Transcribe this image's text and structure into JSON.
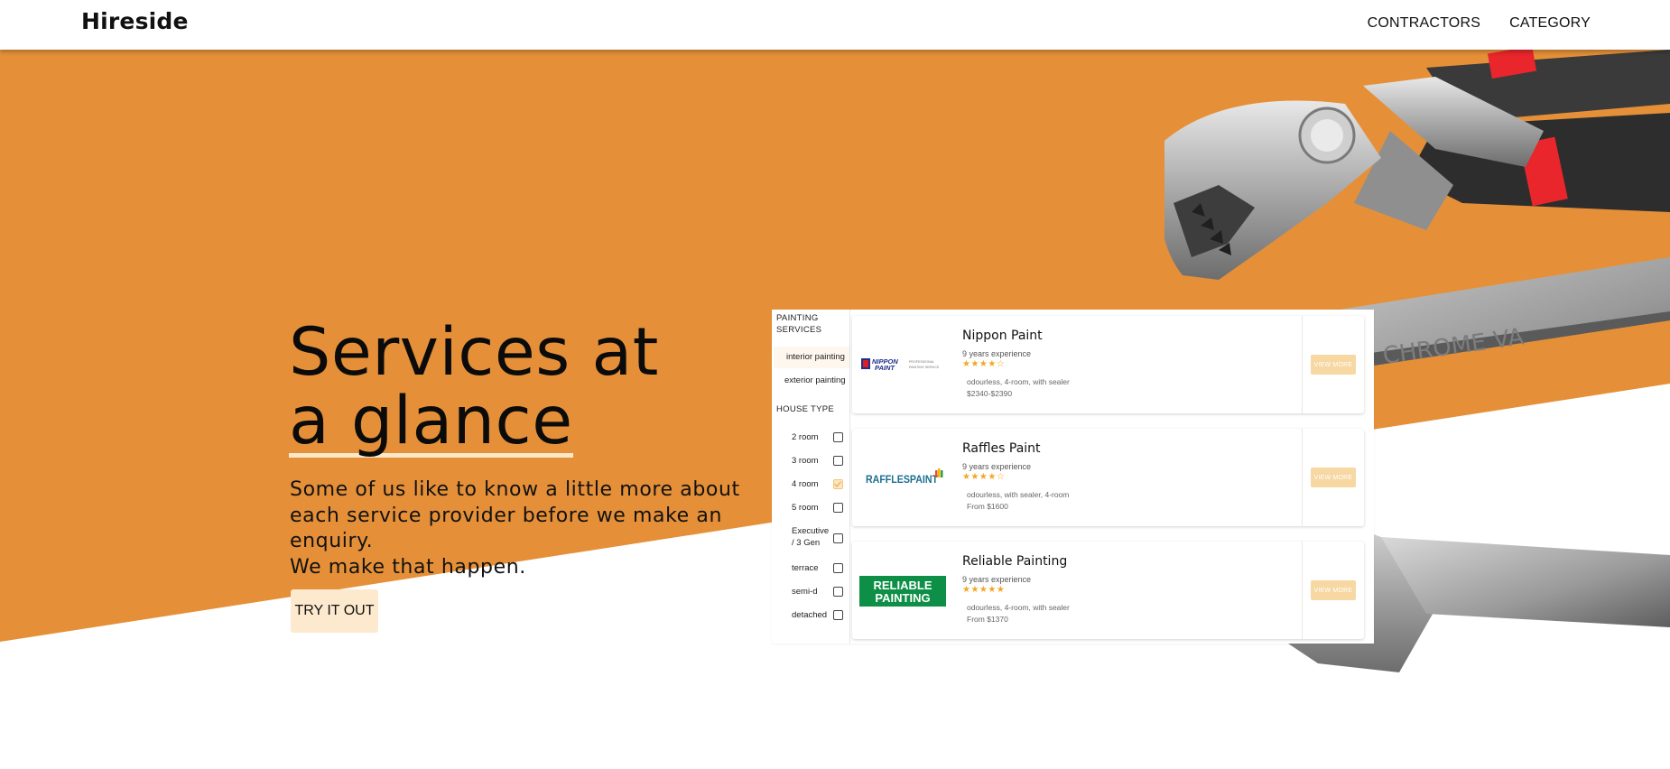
{
  "header": {
    "logo": "Hireside",
    "nav": [
      "CONTRACTORS",
      "CATEGORY"
    ]
  },
  "hero": {
    "title_line1": "Services at",
    "title_line2": "a glance",
    "description_lines": [
      "Some of us like to know a little more about each service provider before we make an enquiry.",
      "We make that happen."
    ],
    "cta_label": "TRY IT OUT"
  },
  "mockup": {
    "services_heading": "PAINTING SERVICES",
    "services": [
      "interior painting",
      "exterior painting"
    ],
    "active_service": "interior painting",
    "house_type_heading": "HOUSE TYPE",
    "house_types": [
      {
        "label": "2 room",
        "checked": false
      },
      {
        "label": "3 room",
        "checked": false
      },
      {
        "label": "4 room",
        "checked": true
      },
      {
        "label": "5 room",
        "checked": false
      },
      {
        "label": "Executive / 3 Gen",
        "checked": false
      },
      {
        "label": "terrace",
        "checked": false
      },
      {
        "label": "semi-d",
        "checked": false
      },
      {
        "label": "detached",
        "checked": false
      }
    ],
    "cards": [
      {
        "name": "Nippon Paint",
        "experience": "9 years experience",
        "stars": "★★★★☆",
        "tags": "odourless, 4-room, with sealer",
        "price": "$2340-$2390",
        "button": "VIEW MORE",
        "logo": {
          "brand": "NIPPON",
          "brand2": "PAINT",
          "sub1": "PROFESSIONAL",
          "sub2": "PAINTING SERVICE"
        }
      },
      {
        "name": "Raffles Paint",
        "experience": "9 years experience",
        "stars": "★★★★☆",
        "tags": "odourless, with sealer, 4-room",
        "price": "From $1600",
        "button": "VIEW MORE",
        "logo": {
          "brand": "RAFFLESPAINT"
        }
      },
      {
        "name": "Reliable Painting",
        "experience": "9 years experience",
        "stars": "★★★★★",
        "tags": "odourless, 4-room, with sealer",
        "price": "From $1370",
        "button": "VIEW MORE",
        "logo": {
          "brand": "RELIABLE",
          "brand2": "PAINTING"
        }
      }
    ]
  },
  "colors": {
    "hero_orange": "#e59038",
    "accent_light": "#fde9cd",
    "star": "#f5a623",
    "reliable_green": "#0e8f47",
    "nippon_blue": "#1d2f8c"
  },
  "icons": [
    "pliers-illustration",
    "wrench-illustration",
    "adjustable-wrench-illustration",
    "checkbox-icon"
  ]
}
